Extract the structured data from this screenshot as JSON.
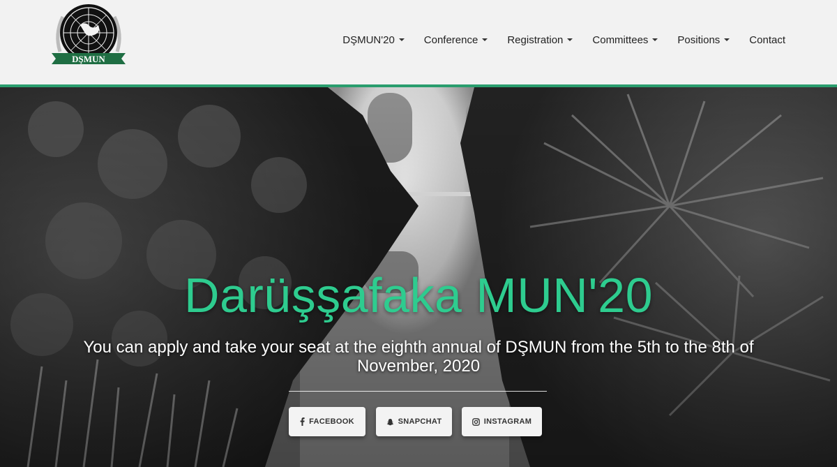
{
  "brand": {
    "logo_text": "DŞMUN",
    "accent_color": "#2a9d6e",
    "title_color": "#2ecc8f"
  },
  "nav": {
    "items": [
      {
        "label": "DŞMUN'20",
        "dropdown": true
      },
      {
        "label": "Conference",
        "dropdown": true
      },
      {
        "label": "Registration",
        "dropdown": true
      },
      {
        "label": "Committees",
        "dropdown": true
      },
      {
        "label": "Positions",
        "dropdown": true
      },
      {
        "label": "Contact",
        "dropdown": false
      }
    ]
  },
  "hero": {
    "title": "Darüşşafaka MUN'20",
    "subtitle": "You can apply and take your seat at the eighth annual of DŞMUN from the 5th to the 8th of November, 2020"
  },
  "social": {
    "facebook": {
      "label": "FACEBOOK",
      "icon": "facebook-icon"
    },
    "snapchat": {
      "label": "SNAPCHAT",
      "icon": "snapchat-icon"
    },
    "instagram": {
      "label": "INSTAGRAM",
      "icon": "instagram-icon"
    }
  }
}
